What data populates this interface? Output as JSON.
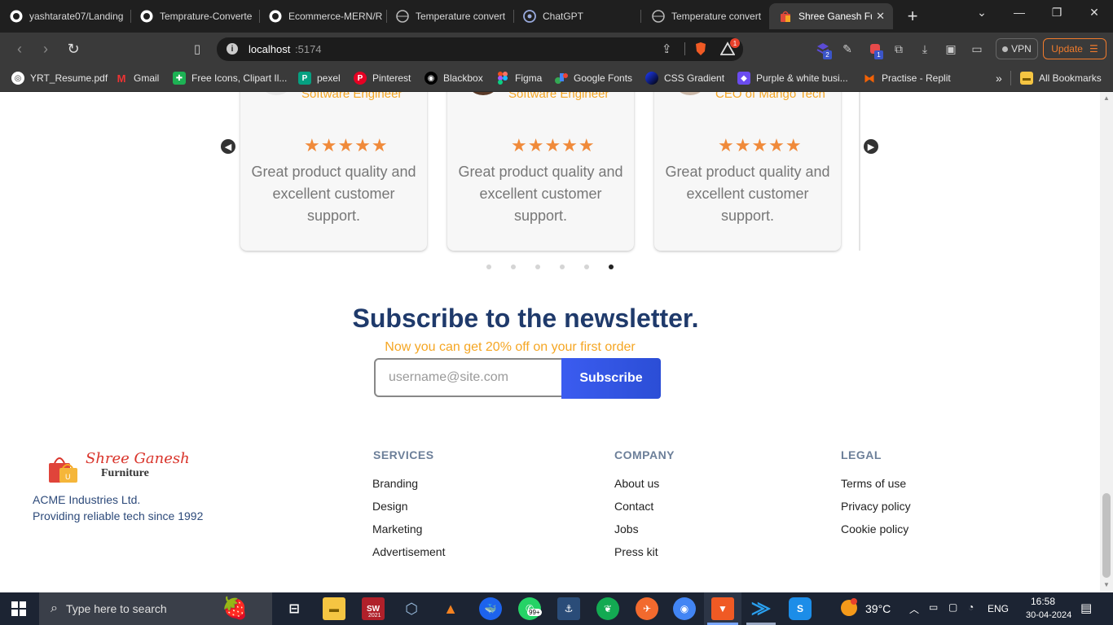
{
  "browser": {
    "tabs": [
      {
        "title": "yashtarate07/Landing"
      },
      {
        "title": "Temprature-Converte"
      },
      {
        "title": "Ecommerce-MERN/R"
      },
      {
        "title": "Temperature convert"
      },
      {
        "title": "ChatGPT"
      },
      {
        "title": "Temperature convert"
      },
      {
        "title": "Shree Ganesh Fu"
      }
    ],
    "url_host": "localhost",
    "url_port": ":5174",
    "vpn_label": "VPN",
    "update_label": "Update",
    "extension_badges": [
      "2",
      "1"
    ],
    "brave_badge": "1",
    "bookmarks": [
      {
        "label": "YRT_Resume.pdf"
      },
      {
        "label": "Gmail"
      },
      {
        "label": "Free Icons, Clipart Il..."
      },
      {
        "label": "pexel"
      },
      {
        "label": "Pinterest"
      },
      {
        "label": "Blackbox"
      },
      {
        "label": "Figma"
      },
      {
        "label": "Google Fonts"
      },
      {
        "label": "CSS Gradient"
      },
      {
        "label": "Purple & white busi..."
      },
      {
        "label": "Practise - Replit"
      }
    ],
    "all_bookmarks": "All Bookmarks"
  },
  "testimonials": {
    "cards": [
      {
        "role": "Software Engineer",
        "rating": 5,
        "quote": "Great product quality and excellent customer support."
      },
      {
        "role": "Software Engineer",
        "rating": 5,
        "quote": "Great product quality and excellent customer support."
      },
      {
        "role": "CEO of Mango Tech",
        "rating": 5,
        "quote": "Great product quality and excellent customer support."
      }
    ],
    "dots_total": 6,
    "active_dot": 6
  },
  "newsletter": {
    "title": "Subscribe to the newsletter.",
    "subtitle": "Now you can get 20% off on your first order",
    "email_placeholder": "username@site.com",
    "button": "Subscribe"
  },
  "footer": {
    "brand_name": "Shree Ganesh",
    "brand_sub": "Furniture",
    "company_line1": "ACME Industries Ltd.",
    "company_line2": "Providing reliable tech since 1992",
    "columns": [
      {
        "heading": "SERVICES",
        "links": [
          "Branding",
          "Design",
          "Marketing",
          "Advertisement"
        ]
      },
      {
        "heading": "COMPANY",
        "links": [
          "About us",
          "Contact",
          "Jobs",
          "Press kit"
        ]
      },
      {
        "heading": "LEGAL",
        "links": [
          "Terms of use",
          "Privacy policy",
          "Cookie policy"
        ]
      }
    ]
  },
  "taskbar": {
    "search_placeholder": "Type here to search",
    "weather": "39°C",
    "language": "ENG",
    "time": "16:58",
    "date": "30-04-2024",
    "whatsapp_badge": "99+",
    "year_label": "2021"
  },
  "colors": {
    "accent_orange": "#f5a623",
    "title_navy": "#1f3a6b",
    "button_blue": "#3b5cf0",
    "star_orange": "#f08a3a"
  }
}
